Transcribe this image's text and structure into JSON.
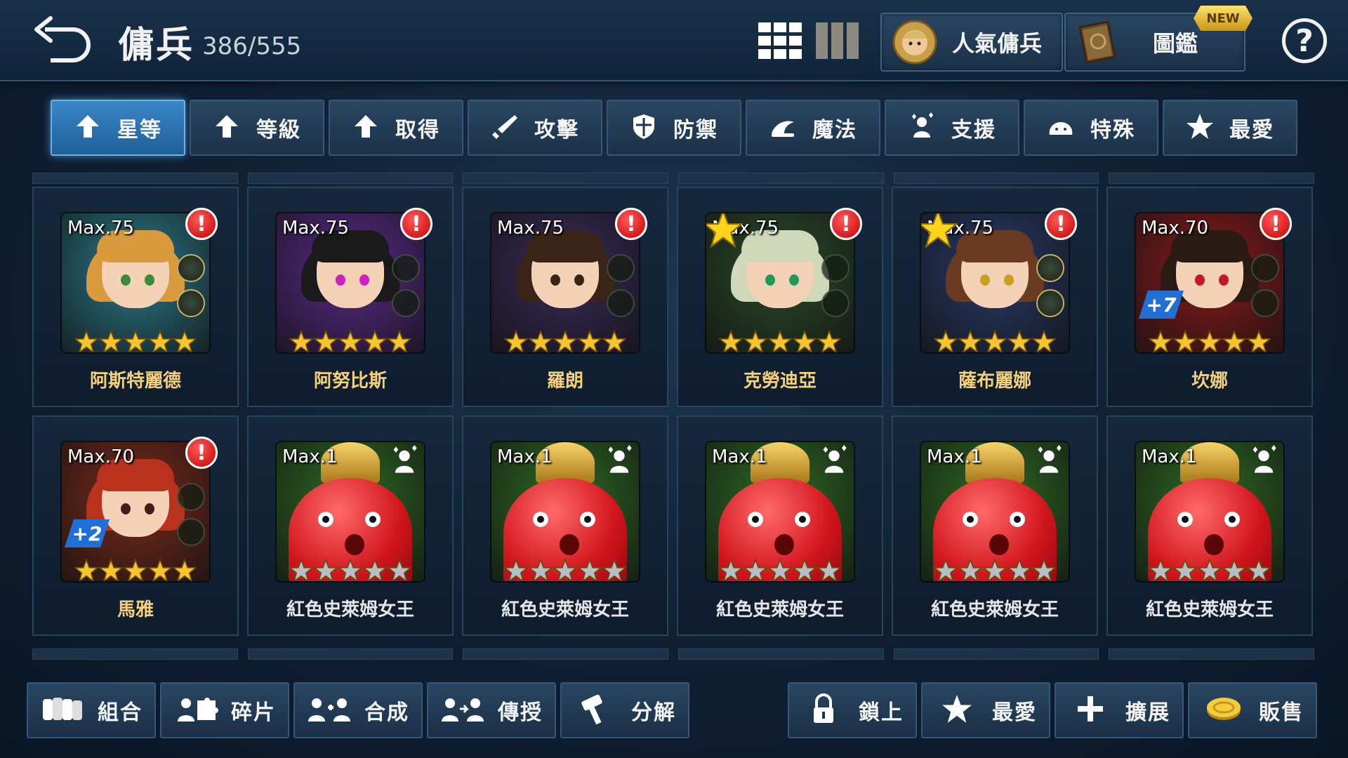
{
  "header": {
    "title": "傭兵",
    "count": "386/555",
    "popular_label": "人氣傭兵",
    "codex_label": "圖鑑",
    "new_badge": "NEW",
    "help_label": "?"
  },
  "sort_tabs": [
    {
      "label": "星等",
      "icon": "up-arrow-icon",
      "active": true
    },
    {
      "label": "等級",
      "icon": "up-arrow-icon",
      "active": false
    },
    {
      "label": "取得",
      "icon": "up-arrow-icon",
      "active": false
    },
    {
      "label": "攻擊",
      "icon": "sword-icon",
      "active": false
    },
    {
      "label": "防禦",
      "icon": "shield-icon",
      "active": false
    },
    {
      "label": "魔法",
      "icon": "magic-icon",
      "active": false
    },
    {
      "label": "支援",
      "icon": "support-icon",
      "active": false
    },
    {
      "label": "特殊",
      "icon": "special-icon",
      "active": false
    },
    {
      "label": "最愛",
      "icon": "star-icon",
      "active": false
    }
  ],
  "mercenaries": [
    {
      "name": "阿斯特麗德",
      "max": "Max.75",
      "stars": 5,
      "alert": "!",
      "favorite": false,
      "plus": "",
      "slots_filled": 2,
      "bg": "#2a7a8a",
      "hair": "#d89a3c",
      "eye": "#3a8a3a",
      "type": "hero",
      "support": false
    },
    {
      "name": "阿努比斯",
      "max": "Max.75",
      "stars": 5,
      "alert": "!",
      "favorite": false,
      "plus": "",
      "slots_filled": 0,
      "bg": "#5a2a8a",
      "hair": "#1a1a1a",
      "eye": "#d020c0",
      "type": "hero",
      "support": false
    },
    {
      "name": "羅朗",
      "max": "Max.75",
      "stars": 5,
      "alert": "!",
      "favorite": false,
      "plus": "",
      "slots_filled": 0,
      "bg": "#3a2a5a",
      "hair": "#3a2418",
      "eye": "#3a2418",
      "type": "hero",
      "support": false
    },
    {
      "name": "克勞迪亞",
      "max": "Max.75",
      "stars": 5,
      "alert": "!",
      "favorite": true,
      "plus": "",
      "slots_filled": 0,
      "bg": "#2a4a2a",
      "hair": "#cfd8b8",
      "eye": "#1e9a5a",
      "type": "hero",
      "support": false
    },
    {
      "name": "薩布麗娜",
      "max": "Max.75",
      "stars": 5,
      "alert": "!",
      "favorite": true,
      "plus": "",
      "slots_filled": 2,
      "bg": "#283a6a",
      "hair": "#6a3a22",
      "eye": "#c8a020",
      "type": "hero",
      "support": false
    },
    {
      "name": "坎娜",
      "max": "Max.70",
      "stars": 5,
      "alert": "!",
      "favorite": false,
      "plus": "+7",
      "slots_filled": 0,
      "bg": "#8a1a1a",
      "hair": "#2a1a14",
      "eye": "#c01a2a",
      "type": "hero",
      "support": false
    },
    {
      "name": "馬雅",
      "max": "Max.70",
      "stars": 5,
      "alert": "!",
      "favorite": false,
      "plus": "+2",
      "slots_filled": 0,
      "bg": "#7a2a1a",
      "hair": "#b8321e",
      "eye": "#4a1a1a",
      "type": "hero",
      "support": false
    },
    {
      "name": "紅色史萊姆女王",
      "max": "Max.1",
      "stars": 5,
      "alert": "",
      "favorite": false,
      "plus": "",
      "slots_filled": 0,
      "bg": "#2e6a22",
      "type": "slime",
      "support": true
    },
    {
      "name": "紅色史萊姆女王",
      "max": "Max.1",
      "stars": 5,
      "alert": "",
      "favorite": false,
      "plus": "",
      "slots_filled": 0,
      "bg": "#2e6a22",
      "type": "slime",
      "support": true
    },
    {
      "name": "紅色史萊姆女王",
      "max": "Max.1",
      "stars": 5,
      "alert": "",
      "favorite": false,
      "plus": "",
      "slots_filled": 0,
      "bg": "#2e6a22",
      "type": "slime",
      "support": true
    },
    {
      "name": "紅色史萊姆女王",
      "max": "Max.1",
      "stars": 5,
      "alert": "",
      "favorite": false,
      "plus": "",
      "slots_filled": 0,
      "bg": "#2e6a22",
      "type": "slime",
      "support": true
    },
    {
      "name": "紅色史萊姆女王",
      "max": "Max.1",
      "stars": 5,
      "alert": "",
      "favorite": false,
      "plus": "",
      "slots_filled": 0,
      "bg": "#2e6a22",
      "type": "slime",
      "support": true
    }
  ],
  "bottom_left": [
    {
      "label": "組合",
      "icon": "team-icon"
    },
    {
      "label": "碎片",
      "icon": "puzzle-icon"
    },
    {
      "label": "合成",
      "icon": "combine-icon"
    },
    {
      "label": "傳授",
      "icon": "transfer-icon"
    },
    {
      "label": "分解",
      "icon": "hammer-icon"
    }
  ],
  "bottom_right": [
    {
      "label": "鎖上",
      "icon": "lock-icon"
    },
    {
      "label": "最愛",
      "icon": "star-icon"
    },
    {
      "label": "擴展",
      "icon": "plus-icon"
    },
    {
      "label": "販售",
      "icon": "coin-icon"
    }
  ],
  "colors": {
    "accent_blue": "#3a86c6",
    "alert_red": "#d40000",
    "gold_star": "#f5c430",
    "grey_star": "#b8bec6",
    "new_gold": "#f5cc3a"
  }
}
